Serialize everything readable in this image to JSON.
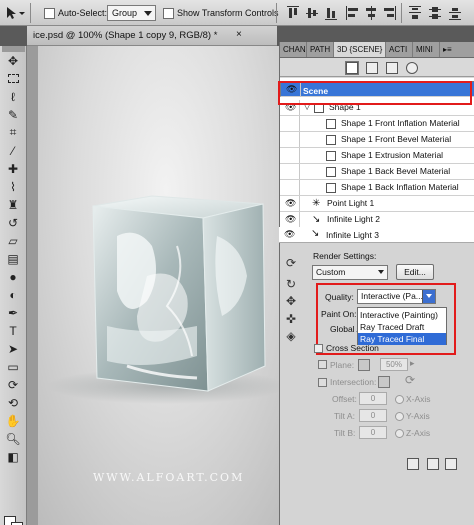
{
  "options_bar": {
    "auto_select_label": "Auto-Select:",
    "auto_select_value": "Group",
    "show_transform_label": "Show Transform Controls"
  },
  "document": {
    "tab_title": "ice.psd @ 100% (Shape 1 copy 9, RGB/8) *",
    "close_glyph": "×"
  },
  "panel": {
    "tabs": [
      "CHAN",
      "PATH",
      "3D {SCENE}",
      "ACTI",
      "MINI"
    ],
    "active_tab": "3D {SCENE}",
    "scene_items": [
      {
        "label": "Scene",
        "selected": true
      },
      {
        "label": "Shape 1"
      },
      {
        "label": "Shape 1 Front Inflation Material"
      },
      {
        "label": "Shape 1 Front Bevel Material"
      },
      {
        "label": "Shape 1 Extrusion Material"
      },
      {
        "label": "Shape 1 Back Bevel Material"
      },
      {
        "label": "Shape 1 Back Inflation Material"
      },
      {
        "label": "Point Light 1"
      },
      {
        "label": "Infinite Light 2"
      },
      {
        "label": "Infinite Light 3"
      }
    ],
    "render": {
      "settings_label": "Render Settings:",
      "preset_value": "Custom",
      "edit_button": "Edit...",
      "quality_label": "Quality:",
      "quality_value": "Interactive (Pa...",
      "quality_options": [
        "Interactive (Painting)",
        "Ray Traced Draft",
        "Ray Traced Final"
      ],
      "quality_highlighted": "Ray Traced Final",
      "paint_on_label": "Paint On:",
      "global_ambient_label": "Global A",
      "cross_section_label": "Cross Section",
      "plane_label": "Plane:",
      "plane_value": "50%",
      "intersection_label": "Intersection:",
      "offset_label": "Offset:",
      "tilt_a_label": "Tilt A:",
      "tilt_b_label": "Tilt B:",
      "x_axis": "X-Axis",
      "y_axis": "Y-Axis",
      "z_axis": "Z-Axis",
      "offset_value": "0",
      "tilt_a_value": "0",
      "tilt_b_value": "0"
    }
  },
  "watermark": "WWW.ALFOART.COM",
  "colors": {
    "highlight": "#3875d7",
    "annotation": "#e21b1b"
  }
}
